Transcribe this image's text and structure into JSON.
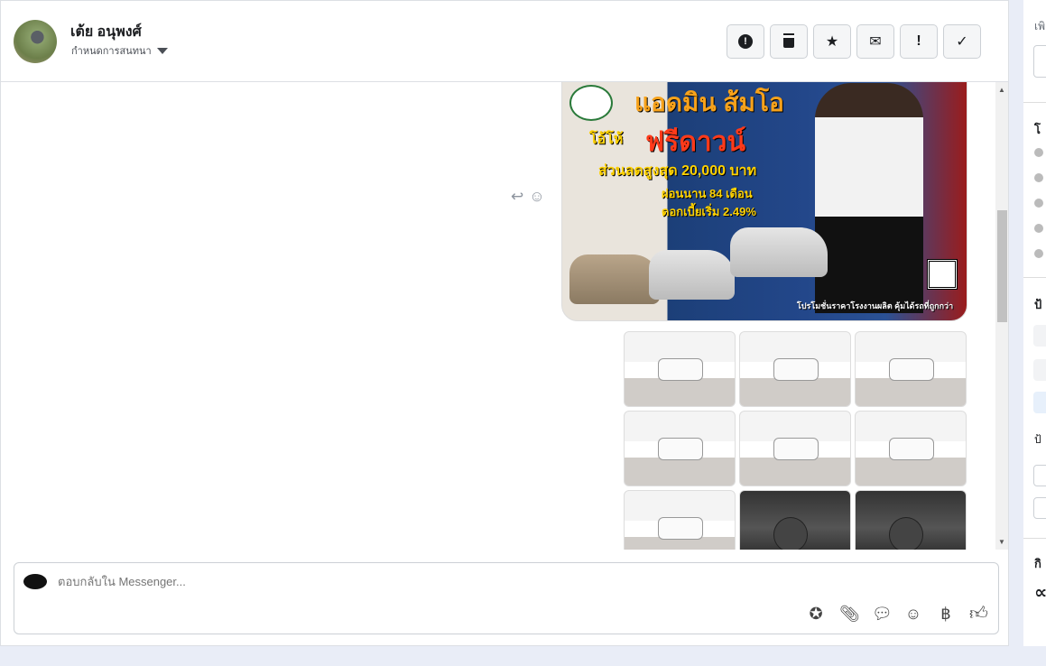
{
  "header": {
    "contact_name": "เต้ย อนุพงศ์",
    "assign_label": "กำหนดการสนทนา"
  },
  "actions": [
    {
      "name": "spam-button",
      "icon": "alert-circle-icon",
      "glyph": "⓿"
    },
    {
      "name": "delete-button",
      "icon": "trash-icon",
      "glyph": "🗑"
    },
    {
      "name": "star-button",
      "icon": "star-icon",
      "glyph": "★"
    },
    {
      "name": "mark-unread-button",
      "icon": "envelope-icon",
      "glyph": "✉"
    },
    {
      "name": "follow-up-button",
      "icon": "exclamation-icon",
      "glyph": "!"
    },
    {
      "name": "done-button",
      "icon": "check-icon",
      "glyph": "✓"
    }
  ],
  "promo": {
    "title": "แอดมิน ส้มโอ",
    "wow": "โอ้โห้",
    "free_down": "ฟรีดาวน์",
    "discount": "ส่วนลดสูงสุด 20,000 บาท",
    "installment": "ผ่อนนาน 84 เดือน",
    "interest": "ดอกเบี้ยเริ่ม 2.49%",
    "footer": "โปรโมชั่นราคาโรงงานผลิต คุ้มได้รถที่ถูกกว่า"
  },
  "composer": {
    "placeholder": "ตอบกลับใน Messenger..."
  },
  "right_panel": {
    "frag1": "เพิ",
    "frag2": "โ",
    "frag3": "ป้",
    "frag4": "ป้",
    "frag5": "กิ",
    "frag6": "∝"
  }
}
